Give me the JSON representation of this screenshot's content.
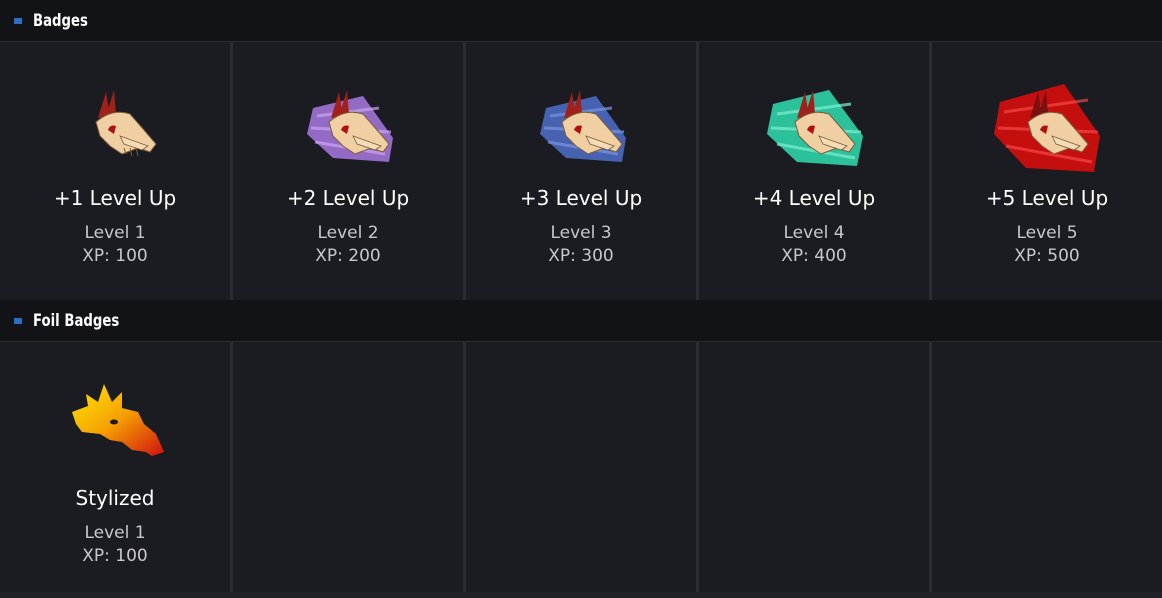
{
  "sections": {
    "badges": {
      "title": "Badges",
      "items": [
        {
          "name": "+1 Level Up",
          "level": "Level 1",
          "xp": "XP: 100",
          "icon": "dragon-skull-badge-icon",
          "aura": "none"
        },
        {
          "name": "+2 Level Up",
          "level": "Level 2",
          "xp": "XP: 200",
          "icon": "dragon-skull-badge-icon",
          "aura": "#a979e0"
        },
        {
          "name": "+3 Level Up",
          "level": "Level 3",
          "xp": "XP: 300",
          "icon": "dragon-skull-badge-icon",
          "aura": "#4f6fc9"
        },
        {
          "name": "+4 Level Up",
          "level": "Level 4",
          "xp": "XP: 400",
          "icon": "dragon-skull-badge-icon",
          "aura": "#2fd3a8"
        },
        {
          "name": "+5 Level Up",
          "level": "Level 5",
          "xp": "XP: 500",
          "icon": "dragon-skull-badge-icon",
          "aura": "#d40e0e"
        }
      ]
    },
    "foil": {
      "title": "Foil Badges",
      "items": [
        {
          "name": "Stylized",
          "level": "Level 1",
          "xp": "XP: 100",
          "icon": "stylized-dragon-badge-icon"
        }
      ]
    }
  },
  "colors": {
    "accent": "#2a6fc2",
    "header_bg": "#121316",
    "cell_bg": "#1b1c21",
    "bone": "#f0cfa3",
    "horn": "#a0201a"
  }
}
